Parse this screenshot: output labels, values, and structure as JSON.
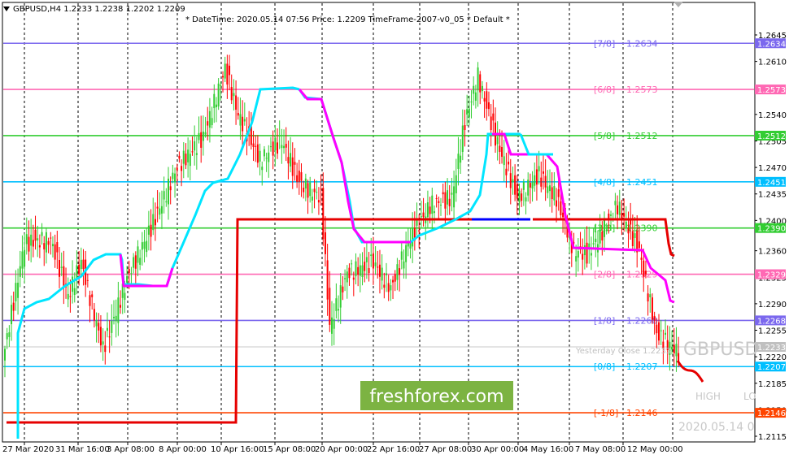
{
  "header": {
    "symbol_info": "GBPUSD,H4  1.2233 1.2238 1.2202 1.2209",
    "info_line": "*      DateTime: 2020.05.14 07:56     Price: 1.2209    TimeFrame-2007-v0_05     *    Default    *"
  },
  "price_axis": {
    "labels": [
      {
        "text": "1.2645",
        "value": 1.2645
      },
      {
        "text": "1.2610",
        "value": 1.261
      },
      {
        "text": "1.2575",
        "value": 1.2575
      },
      {
        "text": "1.2540",
        "value": 1.254
      },
      {
        "text": "1.2505",
        "value": 1.2505
      },
      {
        "text": "1.2470",
        "value": 1.247
      },
      {
        "text": "1.2435",
        "value": 1.2435
      },
      {
        "text": "1.2400",
        "value": 1.24
      },
      {
        "text": "1.2360",
        "value": 1.236
      },
      {
        "text": "1.2325",
        "value": 1.2325
      },
      {
        "text": "1.2290",
        "value": 1.229
      },
      {
        "text": "1.2255",
        "value": 1.2255
      },
      {
        "text": "1.2220",
        "value": 1.222
      },
      {
        "text": "1.2185",
        "value": 1.2185
      },
      {
        "text": "1.2150",
        "value": 1.215
      },
      {
        "text": "1.2115",
        "value": 1.2115
      }
    ]
  },
  "time_axis": {
    "labels": [
      "27 Mar 2020",
      "31 Mar 16:00",
      "3 Apr 08:00",
      "8 Apr 00:00",
      "10 Apr 16:00",
      "15 Apr 08:00",
      "20 Apr 00:00",
      "22 Apr 16:00",
      "27 Apr 08:00",
      "30 Apr 00:00",
      "4 May 16:00",
      "7 May 08:00",
      "12 May 00:00"
    ]
  },
  "murrey_levels": [
    {
      "label": "[7/8]",
      "value": "1.2634",
      "price": 1.2634,
      "color": "#7b68ee"
    },
    {
      "label": "[6/8]",
      "value": "1.2573",
      "price": 1.2573,
      "color": "#ff69b4"
    },
    {
      "label": "[5/8]",
      "value": "1.2512",
      "price": 1.2512,
      "color": "#32cd32"
    },
    {
      "label": "[4/8]",
      "value": "1.2451",
      "price": 1.2451,
      "color": "#00bfff"
    },
    {
      "label": "[3/8]",
      "value": "1.2390",
      "price": 1.239,
      "color": "#32cd32"
    },
    {
      "label": "[2/8]",
      "value": "1.2329",
      "price": 1.2329,
      "color": "#ff69b4"
    },
    {
      "label": "[1/8]",
      "value": "1.2268",
      "price": 1.2268,
      "color": "#7b68ee"
    },
    {
      "label": "[0/8]",
      "value": "1.2207",
      "price": 1.2207,
      "color": "#00bfff"
    },
    {
      "label": "[-1/8]",
      "value": "1.2146",
      "price": 1.2146,
      "color": "#ff4500"
    }
  ],
  "price_tags": [
    {
      "text": "1.2634",
      "price": 1.2634,
      "color": "#7b68ee"
    },
    {
      "text": "1.2573",
      "price": 1.2573,
      "color": "#ff69b4"
    },
    {
      "text": "1.2512",
      "price": 1.2512,
      "color": "#32cd32"
    },
    {
      "text": "1.2451",
      "price": 1.2451,
      "color": "#00bfff"
    },
    {
      "text": "1.2390",
      "price": 1.239,
      "color": "#32cd32"
    },
    {
      "text": "1.2329",
      "price": 1.2329,
      "color": "#ff69b4"
    },
    {
      "text": "1.2268",
      "price": 1.2268,
      "color": "#7b68ee"
    },
    {
      "text": "1.2233",
      "price": 1.2233,
      "color": "#c0c0c0"
    },
    {
      "text": "1.2207",
      "price": 1.2207,
      "color": "#00bfff"
    },
    {
      "text": "1.2146",
      "price": 1.2146,
      "color": "#ff4500"
    }
  ],
  "overlay": {
    "watermark_symbol": "GBPUSD",
    "yesterday_close": "Yesterday Close 1.2233",
    "yesterday_close_price": 1.2233,
    "high_label": "HIGH",
    "low_label": "LO",
    "footer_date": "2020.05.14 0",
    "brand": "freshforex.com",
    "brand_color": "#7cb342"
  },
  "colors": {
    "bull_candle": "#32cd32",
    "bear_candle": "#ff0000",
    "cyan_line": "#00e5ff",
    "magenta_line": "#ff00ff",
    "red_line": "#e60000",
    "blue_segment": "#0000ff"
  }
}
